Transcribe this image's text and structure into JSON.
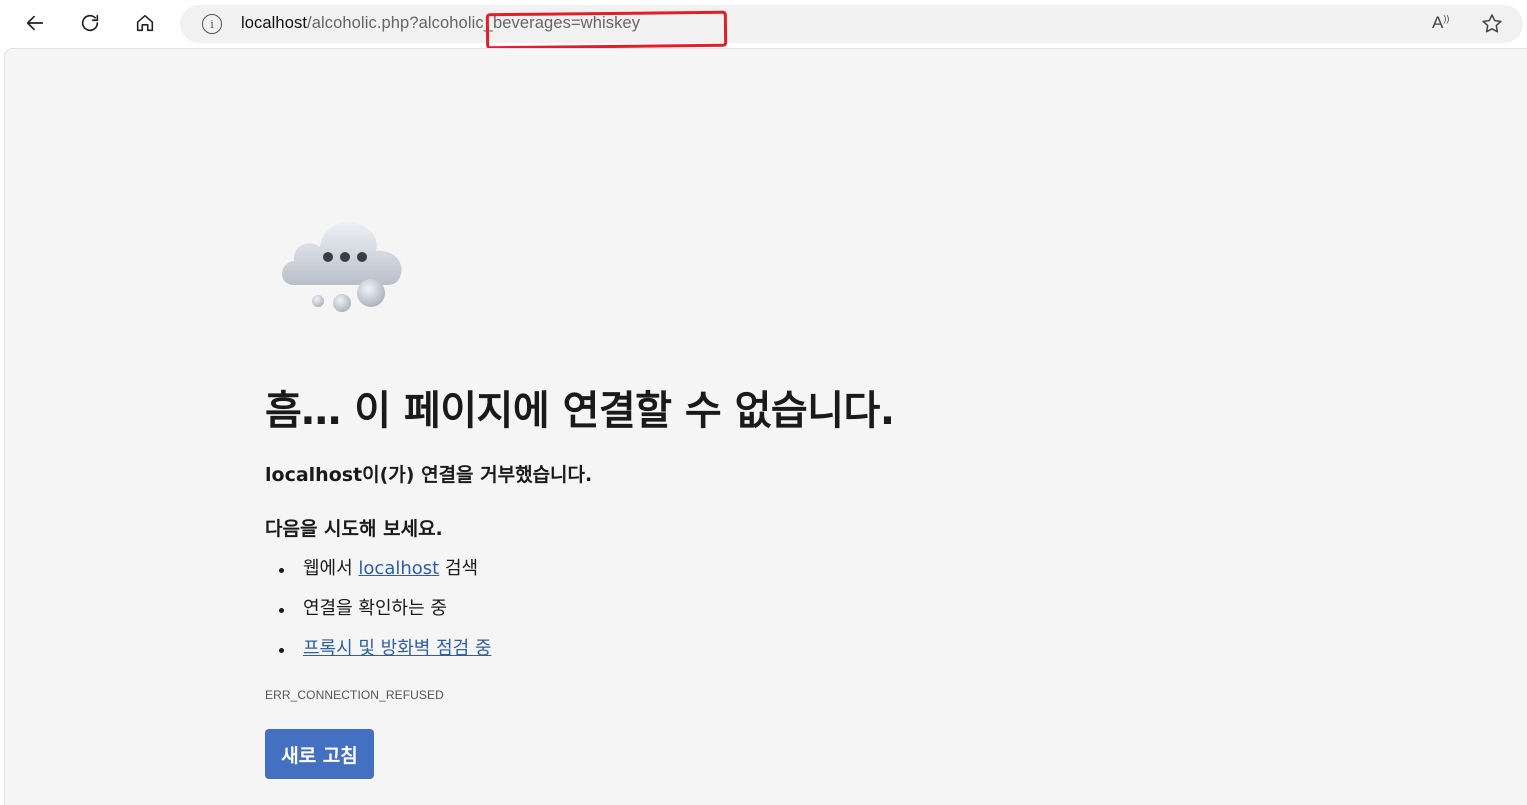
{
  "browser": {
    "url_host": "localhost",
    "url_path": "/alcoholic.php?alcoholic_beverages=whiskey",
    "read_aloud_label": "A",
    "read_aloud_sup": "))"
  },
  "error_page": {
    "title": "흠… 이 페이지에 연결할 수 없습니다.",
    "subtitle": "localhost이(가) 연결을 거부했습니다.",
    "try_heading": "다음을 시도해 보세요.",
    "suggestion_1_prefix": "웹에서 ",
    "suggestion_1_link": "localhost",
    "suggestion_1_suffix": " 검색",
    "suggestion_2": "연결을 확인하는 중",
    "suggestion_3_link": "프록시 및 방화벽 점검 중",
    "error_code": "ERR_CONNECTION_REFUSED",
    "reload_label": "새로 고침"
  },
  "colors": {
    "content_bg": "#f5f5f5",
    "button_bg": "#4470c2",
    "link": "#2e5ea8",
    "highlight": "#e01f26"
  },
  "icons": [
    "back-arrow-icon",
    "refresh-icon",
    "home-icon",
    "info-icon",
    "read-aloud-icon",
    "favorite-star-icon",
    "cloud-ellipsis-icon"
  ]
}
